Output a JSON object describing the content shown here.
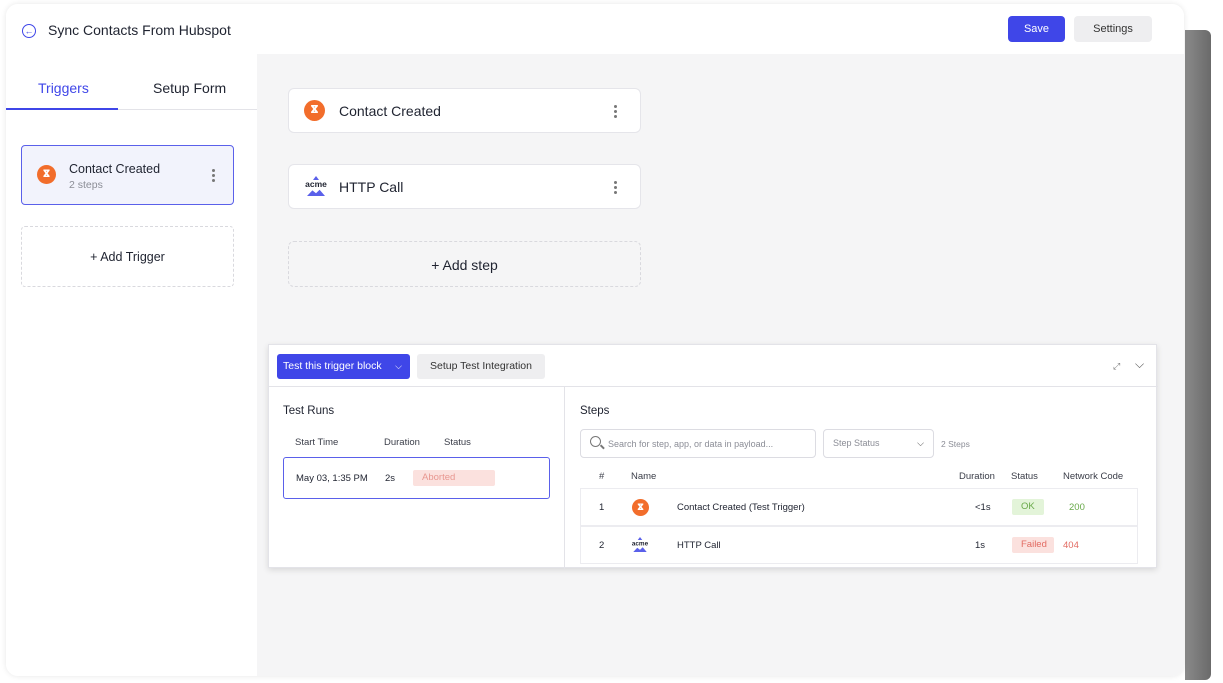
{
  "header": {
    "back_icon": "arrow-left-icon",
    "title": "Sync Contacts From Hubspot",
    "save_label": "Save",
    "settings_label": "Settings"
  },
  "left_panel": {
    "tabs": [
      {
        "label": "Triggers",
        "active": true
      },
      {
        "label": "Setup Form",
        "active": false
      }
    ],
    "trigger": {
      "name": "Contact Created",
      "sub": "2 steps",
      "icon": "hubspot-icon"
    },
    "add_trigger_label": "+ Add Trigger"
  },
  "canvas": {
    "steps": [
      {
        "label": "Contact Created",
        "icon": "hubspot-icon"
      },
      {
        "label": "HTTP Call",
        "icon": "acme-icon"
      }
    ],
    "add_step_label": "+ Add step"
  },
  "test_panel": {
    "test_button_label": "Test this trigger block",
    "setup_test_label": "Setup Test Integration",
    "runs": {
      "title": "Test Runs",
      "headers": [
        "Start Time",
        "Duration",
        "Status"
      ],
      "rows": [
        {
          "start": "May 03, 1:35 PM",
          "duration": "2s",
          "status": "Aborted"
        }
      ]
    },
    "steps": {
      "title": "Steps",
      "search_placeholder": "Search for step, app, or data in payload...",
      "status_select": "Step Status",
      "count": "2 Steps",
      "headers": [
        "#",
        "Name",
        "Duration",
        "Status",
        "Network Code"
      ],
      "rows": [
        {
          "num": "1",
          "name": "Contact Created (Test Trigger)",
          "duration": "<1s",
          "status": "OK",
          "code": "200",
          "icon": "hubspot-icon"
        },
        {
          "num": "2",
          "name": "HTTP Call",
          "duration": "1s",
          "status": "Failed",
          "code": "404",
          "icon": "acme-icon"
        }
      ]
    }
  },
  "colors": {
    "accent": "#3f46e8",
    "hubspot": "#f26d2b",
    "ok": "#68a949",
    "failed": "#e26b62"
  }
}
